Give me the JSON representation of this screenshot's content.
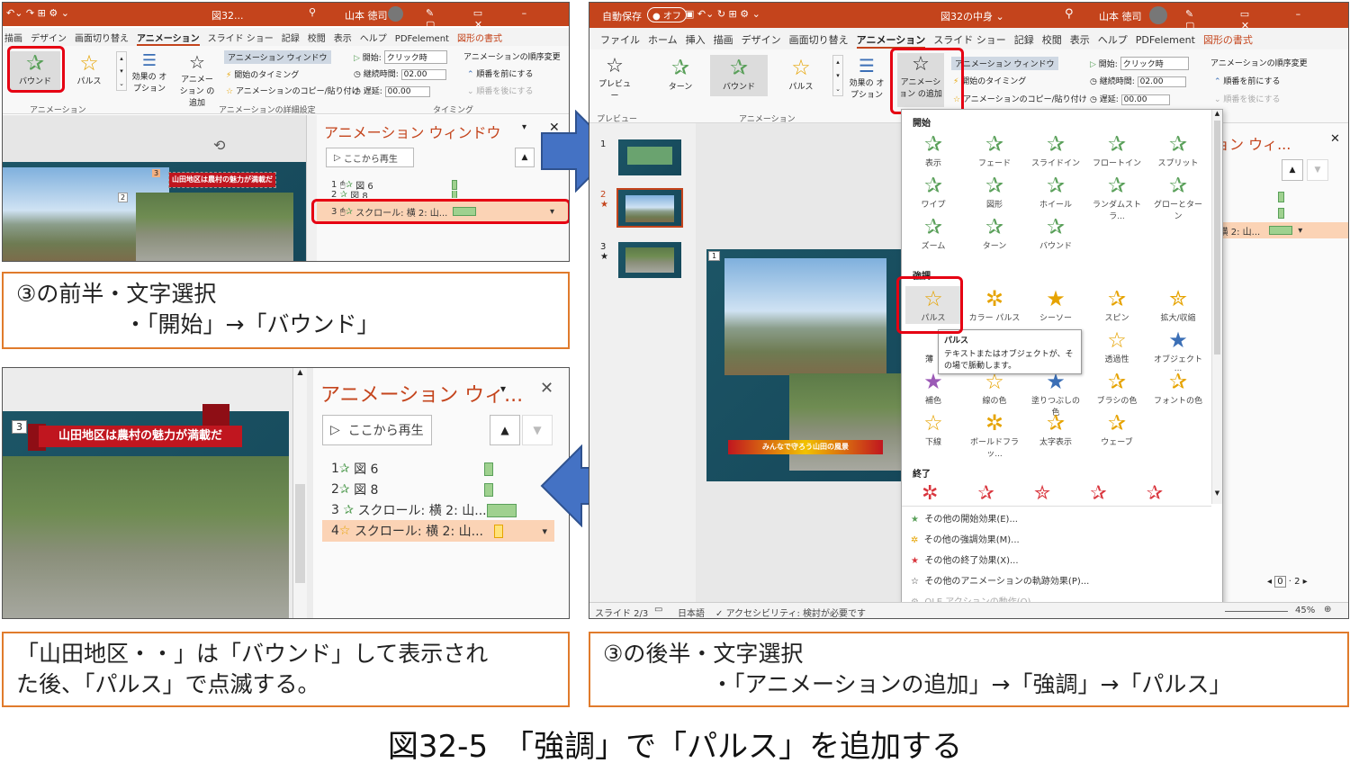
{
  "left_top": {
    "title_text": "図32...",
    "user": "山本 徳司",
    "tabs": [
      "描画",
      "デザイン",
      "画面切り替え",
      "アニメーション",
      "スライド ショー",
      "記録",
      "校閲",
      "表示",
      "ヘルプ",
      "PDFelement",
      "図形の書式"
    ],
    "effects": [
      "バウンド",
      "パルス"
    ],
    "effect_options": "効果の オプション",
    "add_animation": "アニメーション の追加",
    "anim_window": "アニメーション ウィンドウ",
    "start_timing": "開始のタイミング",
    "copy_paste": "アニメーションのコピー/貼り付け",
    "start_label": "開始:",
    "start_value": "クリック時",
    "duration_label": "継続時間:",
    "duration_value": "02.00",
    "delay_label": "遅延:",
    "delay_value": "00.00",
    "reorder": "アニメーションの順序変更",
    "move_earlier": "順番を前にする",
    "move_later": "順番を後にする",
    "grp_anim": "アニメーション",
    "grp_advanced": "アニメーションの詳細設定",
    "grp_timing": "タイミング",
    "pane_title": "アニメーション ウィンドウ",
    "play_from": "ここから再生",
    "rows": [
      "図 6",
      "図 8",
      "スクロール: 横 2: 山..."
    ],
    "row_nums": [
      "1",
      "2",
      "3"
    ],
    "slide_banner": "山田地区は農村の魅力が満載だ",
    "badges": [
      "3",
      "2"
    ]
  },
  "caption1": {
    "line1": "③の前半・文字選択",
    "line2": "・「開始」→「バウンド」"
  },
  "left_bottom": {
    "badge": "3",
    "banner": "山田地区は農村の魅力が満載だ",
    "pane_title": "アニメーション ウィ...",
    "play_from": "ここから再生",
    "rows": [
      "図 6",
      "図 8",
      "スクロール: 横 2: 山...",
      "スクロール: 横 2: 山..."
    ],
    "row_nums": [
      "1",
      "2",
      "3",
      "4"
    ]
  },
  "caption2": {
    "line1": "「山田地区・・」は「バウンド」して表示され",
    "line2": "た後、「パルス」で点滅する。"
  },
  "right": {
    "autosave": "自動保存",
    "autosave_state": "オフ",
    "title_text": "図32の中身",
    "user": "山本 徳司",
    "tabs": [
      "ファイル",
      "ホーム",
      "挿入",
      "描画",
      "デザイン",
      "画面切り替え",
      "アニメーション",
      "スライド ショー",
      "記録",
      "校閲",
      "表示",
      "ヘルプ",
      "PDFelement",
      "図形の書式"
    ],
    "preview": "プレビュー",
    "effects": [
      "ターン",
      "バウンド",
      "パルス"
    ],
    "effect_options": "効果の オプション",
    "add_animation": "アニメーション の追加",
    "anim_window": "アニメーション ウィンドウ",
    "start_timing": "開始のタイミング",
    "copy_paste": "アニメーションのコピー/貼り付け",
    "start_label": "開始:",
    "start_value": "クリック時",
    "duration_label": "継続時間:",
    "duration_value": "02.00",
    "delay_label": "遅延:",
    "delay_value": "00.00",
    "reorder": "アニメーションの順序変更",
    "move_earlier": "順番を前にする",
    "move_later": "順番を後にする",
    "grp_preview": "プレビュー",
    "grp_anim": "アニメーション",
    "thumb_nums": [
      "1",
      "2",
      "3"
    ],
    "section_start": "開始",
    "start_effects": [
      "表示",
      "フェード",
      "スライドイン",
      "フロートイン",
      "スプリット",
      "ワイプ",
      "図形",
      "ホイール",
      "ランダムストラ...",
      "グローとターン",
      "ズーム",
      "ターン",
      "バウンド"
    ],
    "section_emphasis": "強調",
    "emphasis_effects": [
      "パルス",
      "カラー パルス",
      "シーソー",
      "スピン",
      "拡大/収縮",
      "",
      "",
      "",
      "透過性",
      "オブジェクト ...",
      "補色",
      "線の色",
      "塗りつぶしの色",
      "ブラシの色",
      "フォントの色",
      "下線",
      "ボールドフラッ...",
      "太字表示",
      "ウェーブ"
    ],
    "tooltip_title": "パルス",
    "tooltip_body": "テキストまたはオブジェクトが、その場で脈動します。",
    "tooltip_cut": "薄",
    "section_exit": "終了",
    "more_start": "その他の開始効果(E)...",
    "more_emph": "その他の強調効果(M)...",
    "more_exit": "その他の終了効果(X)...",
    "more_path": "その他のアニメーションの軌跡効果(P)...",
    "ole": "OLE アクションの動作(O)...",
    "pane_title": "ョン ウィ...",
    "pane_row": ": 横 2: 山...",
    "status_slide": "スライド 2/3",
    "status_lang": "日本語",
    "status_access": "アクセシビリティ: 検討が必要です",
    "zoom": "45%",
    "slide_badge": "1",
    "slide_banner": "みんなで守ろう山田の風景",
    "page_nav": [
      "0",
      "2"
    ]
  },
  "caption3": {
    "line1": "③の後半・文字選択",
    "line2": "・「アニメーションの追加」→「強調」→「パルス」"
  },
  "figure_title": "図32-5　「強調」で「パルス」を追加する"
}
